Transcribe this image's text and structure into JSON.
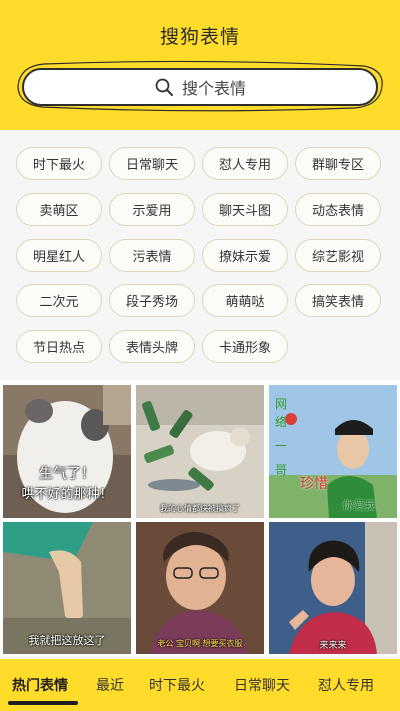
{
  "header": {
    "title": "搜狗表情"
  },
  "search": {
    "placeholder": "搜个表情"
  },
  "tags": [
    "时下最火",
    "日常聊天",
    "怼人专用",
    "群聊专区",
    "卖萌区",
    "示爱用",
    "聊天斗图",
    "动态表情",
    "明星红人",
    "污表情",
    "撩妹示爱",
    "综艺影视",
    "二次元",
    "段子秀场",
    "萌萌哒",
    "搞笑表情",
    "节日热点",
    "表情头牌",
    "卡通形象"
  ],
  "grid": {
    "captions": {
      "cat_big_1": "生气了！",
      "cat_big_2": "哄不好的那种！",
      "cat_bottles": "我的心情都快被搞疯了",
      "star_side_1": "网",
      "star_side_2": "络",
      "star_side_3": "一",
      "star_side_4": "哥",
      "star_main": "珍惜",
      "star_sub": "你爱我",
      "finger": "我就把这放这了",
      "lady": "老公 宝贝啊 想要买衣服",
      "actress": "来来来"
    }
  },
  "tabs": [
    "热门表情",
    "最近",
    "时下最火",
    "日常聊天",
    "怼人专用"
  ],
  "colors": {
    "brand_yellow": "#ffdc2a",
    "tag_border": "#dcd6bd"
  }
}
